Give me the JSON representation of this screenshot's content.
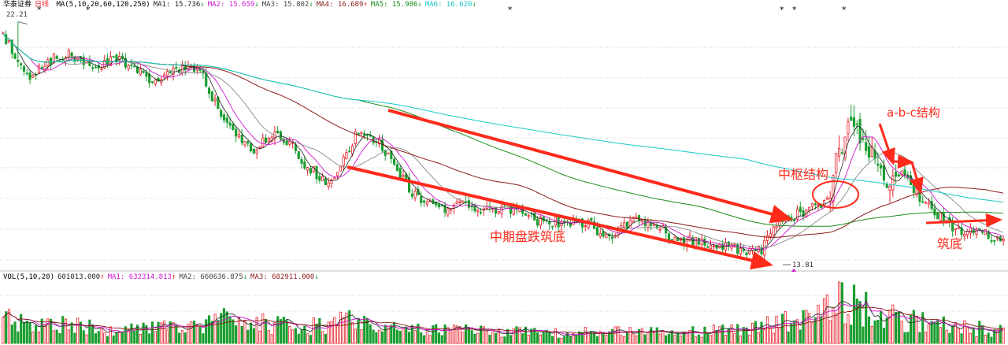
{
  "stock": {
    "name": "华泰证券",
    "period": "日线"
  },
  "price_legend": [
    {
      "text": "MA(5,10,20,60,120,250)",
      "color": "#000000"
    },
    {
      "text": "MA1: 15.736",
      "arrow": "↓",
      "color": "#222222"
    },
    {
      "text": "MA2: 15.659",
      "arrow": "↓",
      "color": "#d015d0"
    },
    {
      "text": "MA3: 15.802",
      "arrow": "↓",
      "color": "#444444"
    },
    {
      "text": "MA4: 16.689",
      "arrow": "↑",
      "color": "#8b1a1a"
    },
    {
      "text": "MA5: 15.986",
      "arrow": "↓",
      "color": "#1a8c1a"
    },
    {
      "text": "MA6: 16.620",
      "arrow": "↓",
      "color": "#19c9c9"
    }
  ],
  "volume_legend": [
    {
      "text": "VOL(5,10,20)",
      "color": "#000000"
    },
    {
      "text": "601013.000",
      "arrow": "↑",
      "color": "#222222"
    },
    {
      "text": "MA1: 632314.813",
      "arrow": "↑",
      "color": "#d015d0"
    },
    {
      "text": "MA2: 660636.875",
      "arrow": "↓",
      "color": "#444444"
    },
    {
      "text": "MA3: 682911.000",
      "arrow": "↓",
      "color": "#8b1a1a"
    }
  ],
  "annotations": {
    "mid_decline": "中期盘跌筑底",
    "pivot": "中枢结构",
    "abc": "a-b-c结构",
    "bottom": "筑底",
    "high_price": "22.21",
    "low_price": "13.81",
    "event_marker": "*"
  },
  "colors": {
    "up": "#e8202a",
    "down": "#1a9e2f",
    "annotation": "#ff2a1a",
    "grid": "#d2d2d2"
  },
  "chart_data": {
    "type": "candlestick",
    "title": "",
    "xlabel": "",
    "ylabel": "",
    "ylim": [
      13.3,
      22.6
    ],
    "max_point": {
      "label": "22.21",
      "value": 22.21
    },
    "min_point": {
      "label": "13.81",
      "value": 13.81
    },
    "price_anchors": [
      [
        0,
        21.8
      ],
      [
        8,
        20.2
      ],
      [
        15,
        20.8
      ],
      [
        22,
        21.0
      ],
      [
        30,
        20.5
      ],
      [
        38,
        20.9
      ],
      [
        46,
        20.3
      ],
      [
        52,
        20.0
      ],
      [
        60,
        20.6
      ],
      [
        66,
        20.4
      ],
      [
        72,
        19.0
      ],
      [
        78,
        18.0
      ],
      [
        84,
        17.6
      ],
      [
        90,
        18.1
      ],
      [
        96,
        17.8
      ],
      [
        102,
        16.9
      ],
      [
        110,
        16.3
      ],
      [
        118,
        18.1
      ],
      [
        126,
        17.8
      ],
      [
        132,
        16.7
      ],
      [
        138,
        15.9
      ],
      [
        146,
        15.3
      ],
      [
        154,
        15.6
      ],
      [
        162,
        15.3
      ],
      [
        170,
        15.4
      ],
      [
        180,
        14.9
      ],
      [
        188,
        14.9
      ],
      [
        196,
        14.9
      ],
      [
        202,
        14.3
      ],
      [
        210,
        14.9
      ],
      [
        218,
        14.9
      ],
      [
        224,
        14.3
      ],
      [
        232,
        14.2
      ],
      [
        240,
        14.1
      ],
      [
        248,
        13.9
      ],
      [
        254,
        13.9
      ],
      [
        258,
        14.8
      ],
      [
        264,
        15.1
      ],
      [
        270,
        15.4
      ],
      [
        276,
        15.7
      ],
      [
        280,
        17.5
      ],
      [
        284,
        18.7
      ],
      [
        290,
        17.6
      ],
      [
        296,
        16.3
      ],
      [
        302,
        16.7
      ],
      [
        308,
        15.6
      ],
      [
        314,
        15.1
      ],
      [
        320,
        14.6
      ],
      [
        326,
        14.7
      ],
      [
        330,
        14.4
      ],
      [
        335,
        14.3
      ]
    ],
    "volume_anchors": [
      [
        0,
        0.55
      ],
      [
        20,
        0.4
      ],
      [
        40,
        0.3
      ],
      [
        60,
        0.35
      ],
      [
        72,
        0.55
      ],
      [
        100,
        0.35
      ],
      [
        120,
        0.55
      ],
      [
        140,
        0.3
      ],
      [
        180,
        0.25
      ],
      [
        220,
        0.25
      ],
      [
        250,
        0.3
      ],
      [
        258,
        0.45
      ],
      [
        270,
        0.6
      ],
      [
        278,
        1.0
      ],
      [
        284,
        0.9
      ],
      [
        292,
        0.7
      ],
      [
        300,
        0.55
      ],
      [
        320,
        0.35
      ],
      [
        335,
        0.3
      ]
    ]
  }
}
